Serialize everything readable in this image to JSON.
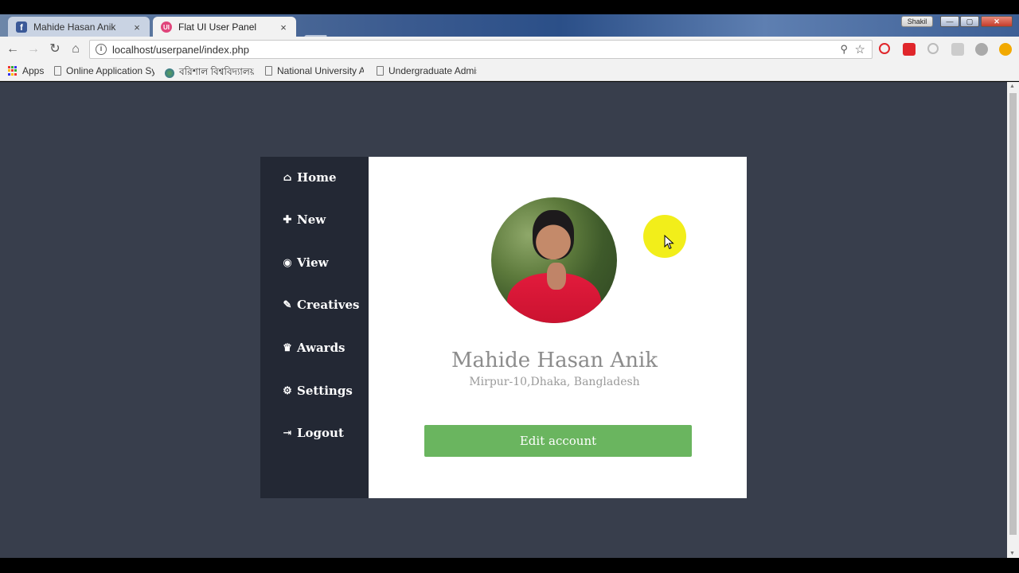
{
  "window": {
    "profile_name": "Shakil",
    "controls": {
      "minimize": "—",
      "maximize": "▢",
      "close": "✕"
    }
  },
  "tabs": [
    {
      "title": "Mahide Hasan Anik",
      "favicon": "facebook-favicon",
      "close": "×",
      "active": false
    },
    {
      "title": "Flat UI User Panel",
      "favicon": "ui-favicon",
      "close": "×",
      "active": true
    }
  ],
  "toolbar": {
    "back": "←",
    "forward": "→",
    "reload": "↻",
    "home": "⌂",
    "url": "localhost/userpanel/index.php",
    "info_icon": "i",
    "key_icon": "⚲",
    "star_icon": "☆"
  },
  "bookmarks": [
    {
      "label": "Apps",
      "icon": "apps-grid-icon"
    },
    {
      "label": "Online Application Sy",
      "icon": "page-icon"
    },
    {
      "label": "বরিশাল বিশ্ববিদ্যালয়",
      "icon": "globe-icon"
    },
    {
      "label": "National University Ac",
      "icon": "page-icon"
    },
    {
      "label": "Undergraduate Admis",
      "icon": "page-icon"
    }
  ],
  "sidebar": {
    "items": [
      {
        "label": "Home",
        "icon": "home-icon",
        "glyph": "⌂"
      },
      {
        "label": "New",
        "icon": "plus-icon",
        "glyph": "✚"
      },
      {
        "label": "View",
        "icon": "eye-icon",
        "glyph": "◉"
      },
      {
        "label": "Creatives",
        "icon": "brush-icon",
        "glyph": "✎"
      },
      {
        "label": "Awards",
        "icon": "trophy-icon",
        "glyph": "♛"
      },
      {
        "label": "Settings",
        "icon": "gears-icon",
        "glyph": "⚙"
      },
      {
        "label": "Logout",
        "icon": "sign-out-icon",
        "glyph": "⇥"
      }
    ]
  },
  "profile": {
    "name": "Mahide Hasan Anik",
    "location": "Mirpur-10,Dhaka, Bangladesh",
    "edit_button": "Edit account"
  },
  "colors": {
    "page_bg": "#383e4c",
    "sidebar_bg": "#232834",
    "button_green": "#6ab55f",
    "cursor_highlight": "#f2ee1a"
  }
}
